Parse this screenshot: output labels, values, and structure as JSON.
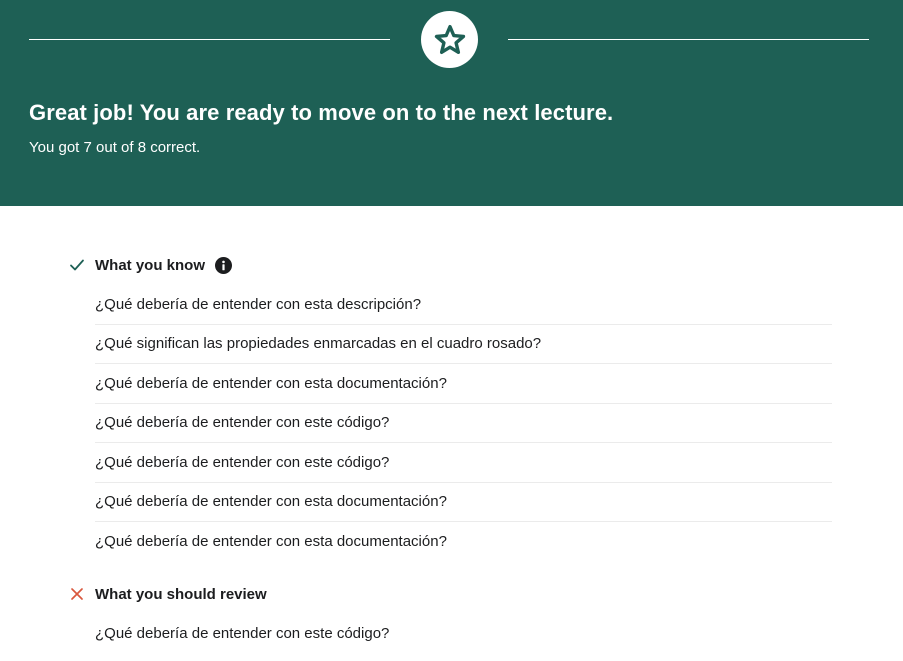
{
  "colors": {
    "banner": "#1e6055",
    "correct": "#1e6055",
    "incorrect": "#d9573d",
    "text": "#1c1d1f"
  },
  "banner": {
    "icon": "star-icon",
    "headline": "Great job! You are ready to move on to the next lecture.",
    "subline": "You got 7 out of 8 correct."
  },
  "know": {
    "icon": "check-icon",
    "title": "What you know",
    "info_icon": "info-icon",
    "items": [
      "¿Qué debería de entender con esta descripción?",
      "¿Qué significan las propiedades enmarcadas en el cuadro rosado?",
      "¿Qué debería de entender con esta documentación?",
      "¿Qué debería de entender con este código?",
      "¿Qué debería de entender con este código?",
      "¿Qué debería de entender con esta documentación?",
      "¿Qué debería de entender con esta documentación?"
    ]
  },
  "review": {
    "icon": "x-icon",
    "title": "What you should review",
    "items": [
      "¿Qué debería de entender con este código?"
    ]
  }
}
